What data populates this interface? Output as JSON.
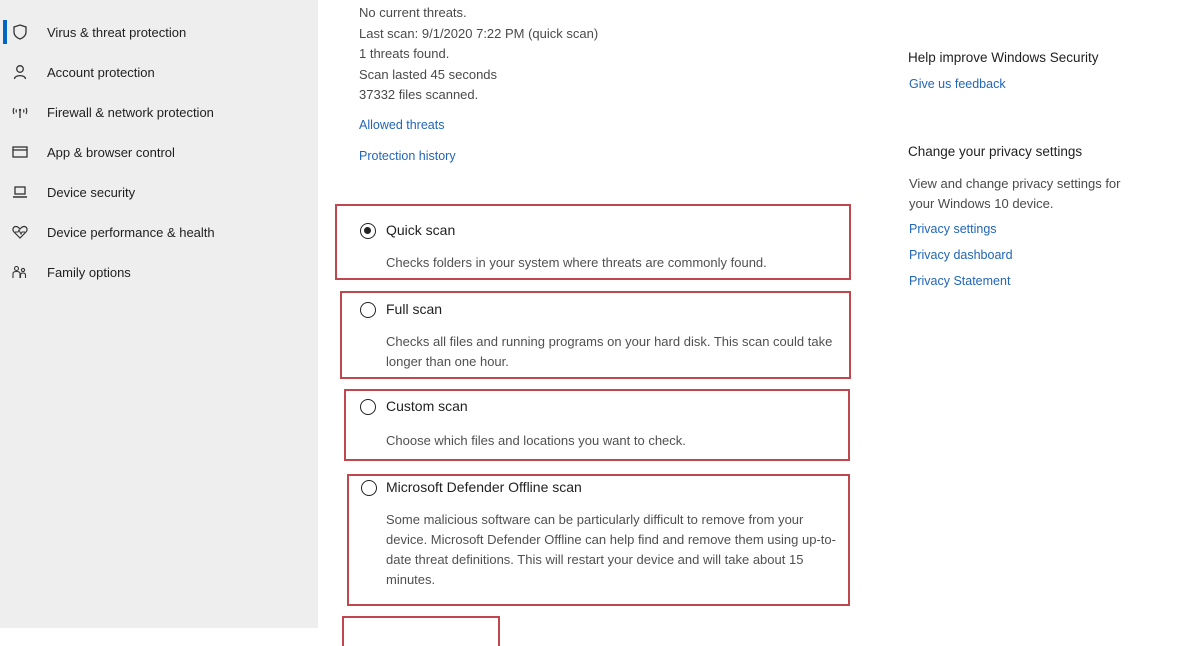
{
  "sidebar": {
    "items": [
      {
        "label": "Virus & threat protection",
        "icon": "shield-icon",
        "selected": true
      },
      {
        "label": "Account protection",
        "icon": "person-icon"
      },
      {
        "label": "Firewall & network protection",
        "icon": "wifi-antenna-icon"
      },
      {
        "label": "App & browser control",
        "icon": "browser-window-icon"
      },
      {
        "label": "Device security",
        "icon": "laptop-icon"
      },
      {
        "label": "Device performance & health",
        "icon": "heart-icon"
      },
      {
        "label": "Family options",
        "icon": "family-icon"
      }
    ],
    "accent": "#0067c0"
  },
  "status": {
    "no_threats": "No current threats.",
    "last_scan": "Last scan: 9/1/2020 7:22 PM (quick scan)",
    "threats_found": "1 threats found.",
    "scan_duration": "Scan lasted 45 seconds",
    "files_scanned": "37332 files scanned."
  },
  "links": {
    "allowed_threats": "Allowed threats",
    "protection_history": "Protection history"
  },
  "scan_options": {
    "selected": "Quick scan",
    "quick": {
      "title": "Quick scan",
      "desc": "Checks folders in your system where threats are commonly found."
    },
    "full": {
      "title": "Full scan",
      "desc": "Checks all files and running programs on your hard disk. This scan could take longer than one hour."
    },
    "custom": {
      "title": "Custom scan",
      "desc": "Choose which files and locations you want to check."
    },
    "offline": {
      "title": "Microsoft Defender Offline scan",
      "desc": "Some malicious software can be particularly difficult to remove from your device. Microsoft Defender Offline can help find and remove them using up-to-date threat definitions. This will restart your device and will take about 15 minutes."
    },
    "highlight_color": "#c0474d"
  },
  "right_panel": {
    "improve_heading": "Help improve Windows Security",
    "feedback_link": "Give us feedback",
    "privacy_heading": "Change your privacy settings",
    "privacy_text": "View and change privacy settings for your Windows 10 device.",
    "privacy_settings_link": "Privacy settings",
    "privacy_dashboard_link": "Privacy dashboard",
    "privacy_statement_link": "Privacy Statement",
    "link_color": "#2266b8"
  }
}
